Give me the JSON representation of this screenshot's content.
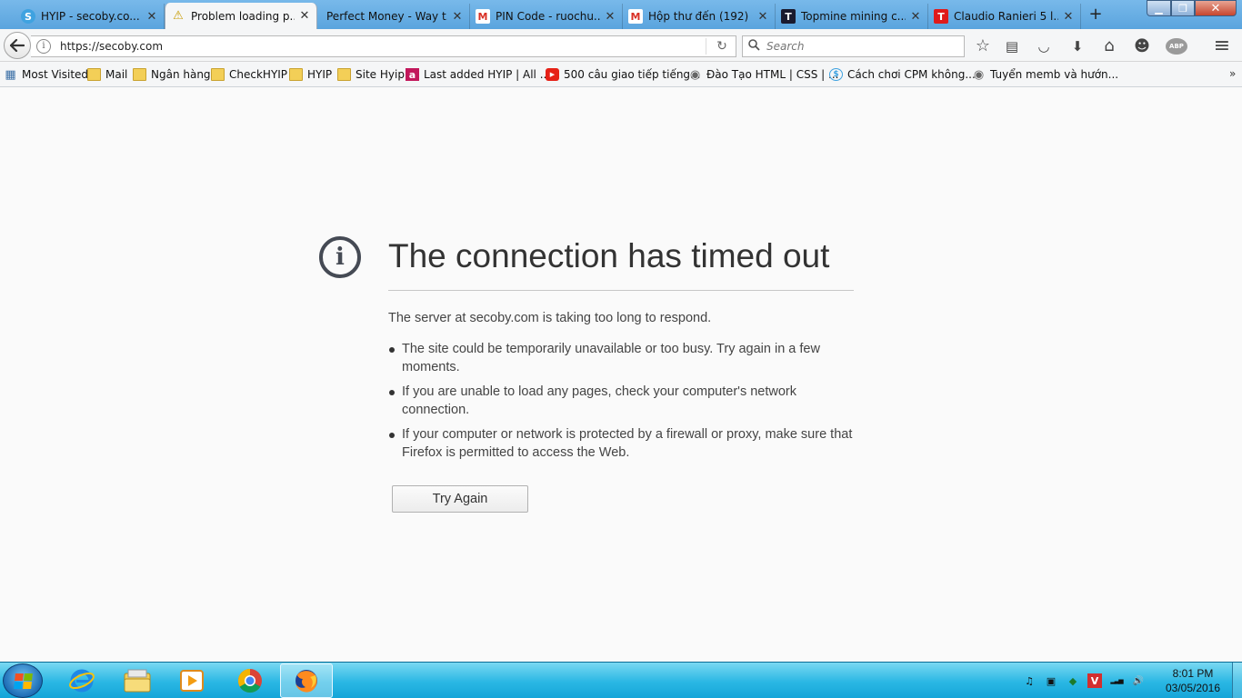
{
  "window": {
    "minimize_glyph": "▁",
    "maximize_glyph": "❐",
    "close_glyph": "✕"
  },
  "tabs": [
    {
      "label": "HYIP - secoby.co...",
      "icon": "secoby-favicon",
      "icon_glyph": "S",
      "active": false
    },
    {
      "label": "Problem loading p...",
      "icon": "warning-icon",
      "icon_glyph": "⚠",
      "active": true
    },
    {
      "label": "Perfect Money - Way t...",
      "icon": "",
      "icon_glyph": "",
      "active": false
    },
    {
      "label": "PIN Code - ruochu...",
      "icon": "gmail-icon",
      "icon_glyph": "M",
      "active": false
    },
    {
      "label": "Hộp thư đến (192) ...",
      "icon": "gmail-icon",
      "icon_glyph": "M",
      "active": false
    },
    {
      "label": "Topmine mining c...",
      "icon": "topmine-favicon",
      "icon_glyph": "T",
      "active": false
    },
    {
      "label": "Claudio Ranieri 5 l...",
      "icon": "t-favicon",
      "icon_glyph": "T",
      "active": false
    }
  ],
  "new_tab_glyph": "+",
  "tab_close_glyph": "✕",
  "navbar": {
    "url": "https://secoby.com",
    "search_placeholder": "Search",
    "reload_glyph": "↻",
    "back_glyph": "←",
    "info_glyph": "i",
    "search_glyph": "🔍"
  },
  "toolbar_icons": [
    {
      "name": "bookmark-star-icon",
      "glyph": "☆"
    },
    {
      "name": "reading-list-icon",
      "glyph": "▤"
    },
    {
      "name": "pocket-icon",
      "glyph": "◡"
    },
    {
      "name": "download-icon",
      "glyph": "⬇"
    },
    {
      "name": "home-icon",
      "glyph": "⌂"
    },
    {
      "name": "smiley-icon",
      "glyph": "☻"
    },
    {
      "name": "adblock-icon",
      "glyph": "ABP"
    },
    {
      "name": "menu-icon",
      "glyph": "≡"
    }
  ],
  "bookmarks": [
    {
      "label": "Most Visited",
      "icon": "most-visited-icon",
      "glyph": "▦"
    },
    {
      "label": "Mail",
      "icon": "folder-icon",
      "glyph": ""
    },
    {
      "label": "Ngân hàng",
      "icon": "folder-icon",
      "glyph": ""
    },
    {
      "label": "CheckHYIP",
      "icon": "folder-icon",
      "glyph": ""
    },
    {
      "label": "HYIP",
      "icon": "folder-icon",
      "glyph": ""
    },
    {
      "label": "Site Hyip",
      "icon": "folder-icon",
      "glyph": ""
    },
    {
      "label": "Last added HYIP | All ...",
      "icon": "a-favicon",
      "glyph": "a"
    },
    {
      "label": "500 câu giao tiếp tiếng...",
      "icon": "youtube-icon",
      "glyph": "▶"
    },
    {
      "label": "Đào Tạo HTML | CSS | ...",
      "icon": "globe-icon",
      "glyph": "◉"
    },
    {
      "label": "Cách chơi CPM không...",
      "icon": "dollar-icon",
      "glyph": "$"
    },
    {
      "label": "Tuyển memb và hướn...",
      "icon": "globe-icon",
      "glyph": "◉"
    }
  ],
  "bookmarks_more_glyph": "»",
  "error": {
    "icon_glyph": "i",
    "title": "The connection has timed out",
    "description": "The server at secoby.com is taking too long to respond.",
    "bullets": [
      "The site could be temporarily unavailable or too busy. Try again in a few moments.",
      "If you are unable to load any pages, check your computer's network connection.",
      "If your computer or network is protected by a firewall or proxy, make sure that Firefox is permitted to access the Web."
    ],
    "try_again_label": "Try Again"
  },
  "taskbar": {
    "apps": [
      {
        "name": "internet-explorer-icon",
        "active": false
      },
      {
        "name": "file-explorer-icon",
        "active": false
      },
      {
        "name": "media-player-icon",
        "active": false
      },
      {
        "name": "chrome-icon",
        "active": false
      },
      {
        "name": "firefox-icon",
        "active": true
      }
    ],
    "tray_icons": [
      {
        "name": "audio-device-icon",
        "glyph": "♫"
      },
      {
        "name": "tray-app-icon",
        "glyph": "▣"
      },
      {
        "name": "network-share-icon",
        "glyph": "◆"
      },
      {
        "name": "unikey-icon",
        "glyph": "V"
      },
      {
        "name": "signal-icon",
        "glyph": "▂▃▅"
      },
      {
        "name": "volume-icon",
        "glyph": "🔊"
      }
    ],
    "time": "8:01 PM",
    "date": "03/05/2016"
  },
  "colors": {
    "tab_strip": "#5aa4de",
    "error_icon": "#454a54",
    "taskbar": "#2ab7e4",
    "gmail_red": "#d93025",
    "youtube_red": "#e62117"
  }
}
